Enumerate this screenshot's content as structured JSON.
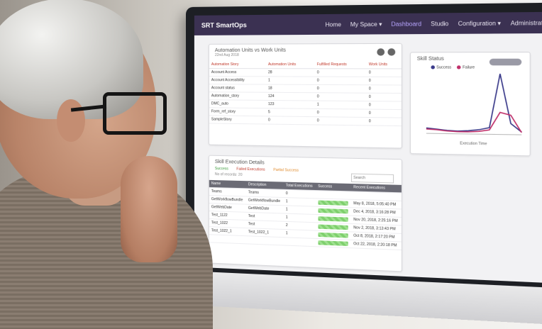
{
  "app": {
    "brand": "SRT SmartOps"
  },
  "nav": [
    "Home",
    "My Space ▾",
    "Dashboard",
    "Studio",
    "Configuration ▾",
    "Administration"
  ],
  "auto_panel": {
    "title": "Automation Units vs Work Units",
    "date": "22nd Aug 2018",
    "headers": [
      "Automation Story",
      "Automation Units",
      "Fulfilled Requests",
      "Work Units"
    ],
    "rows": [
      [
        "Account Access",
        "28",
        "0",
        "0"
      ],
      [
        "Account Accessibility",
        "1",
        "0",
        "0"
      ],
      [
        "Account status",
        "18",
        "0",
        "0"
      ],
      [
        "Automation_story",
        "124",
        "0",
        "0"
      ],
      [
        "DMC_auto",
        "123",
        "1",
        "0"
      ],
      [
        "Form_ref_story",
        "5",
        "0",
        "0"
      ],
      [
        "SampleStory",
        "0",
        "0",
        "0"
      ]
    ]
  },
  "status_panel": {
    "title": "Skill Status",
    "legend": [
      "Success",
      "Failure"
    ],
    "xlabel": "Execution Time"
  },
  "exec_panel": {
    "title": "Skill Execution Details",
    "filters": [
      "Success",
      "Failed Executions",
      "Partial Success"
    ],
    "count": "No of records: 20",
    "search_placeholder": "Search",
    "headers": [
      "Name",
      "Description",
      "Total Executions",
      "Success",
      "Recent Executions"
    ],
    "rows": [
      [
        "Teams",
        "Teams",
        "0",
        "",
        ""
      ],
      [
        "GetWorkflowBundle",
        "GetWorkflowBundle",
        "1",
        "",
        "May 8, 2018, 5:05:40 PM"
      ],
      [
        "GetWebDate",
        "GetWebDate",
        "1",
        "",
        "Dec 4, 2018, 3:16:28 PM"
      ],
      [
        "Test_1122",
        "Test",
        "1",
        "",
        "Nov 20, 2018, 2:25:16 PM"
      ],
      [
        "Test_1022",
        "Test",
        "2",
        "",
        "Nov 2, 2018, 3:13:43 PM"
      ],
      [
        "Test_1022_1",
        "Test_1022_1",
        "1",
        "",
        "Oct 8, 2018, 2:17:20 PM"
      ],
      [
        "",
        "",
        "",
        "",
        "Oct 22, 2018, 2:20:18 PM"
      ]
    ]
  },
  "colors": {
    "topbar": "#3b3152",
    "success": "#3a3a8a",
    "failure": "#c0306a"
  },
  "chart_data": {
    "type": "line",
    "xlabel": "Execution Time",
    "series": [
      {
        "name": "Success",
        "values": [
          10,
          8,
          6,
          5,
          6,
          8,
          12,
          110,
          20,
          5
        ]
      },
      {
        "name": "Failure",
        "values": [
          8,
          7,
          5,
          4,
          4,
          5,
          8,
          40,
          35,
          4
        ]
      }
    ]
  }
}
